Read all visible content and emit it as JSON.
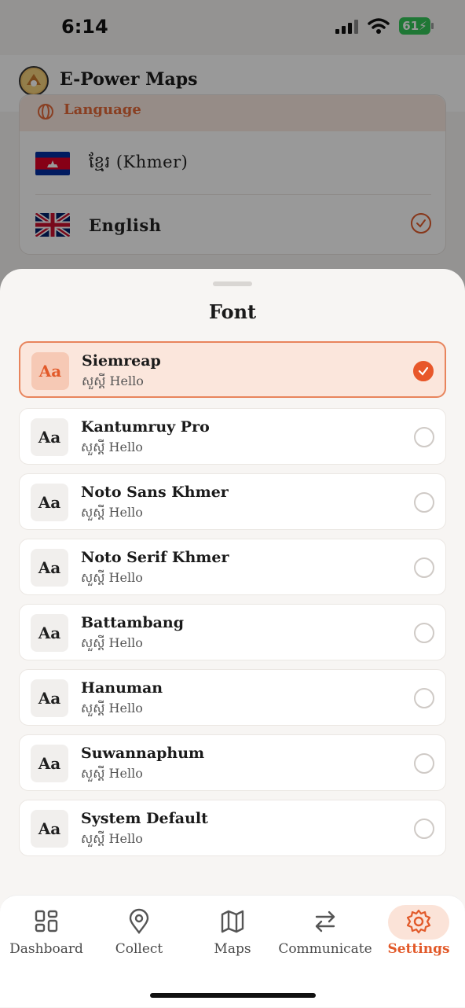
{
  "status_bar": {
    "time": "6:14",
    "battery": "61"
  },
  "app_bar": {
    "title": "E-Power Maps"
  },
  "language_card": {
    "header": "Language",
    "options": [
      {
        "label": "ខ្មែរ (Khmer)",
        "flag": "cambodia-flag-icon",
        "selected": false
      },
      {
        "label": "English",
        "flag": "uk-flag-icon",
        "selected": true
      }
    ]
  },
  "font_sheet": {
    "title": "Font",
    "items": [
      {
        "name": "Siemreap",
        "sample": "សួស្តី Hello",
        "badge": "Aa",
        "selected": true
      },
      {
        "name": "Kantumruy Pro",
        "sample": "សួស្តី Hello",
        "badge": "Aa",
        "selected": false
      },
      {
        "name": "Noto Sans Khmer",
        "sample": "សួស្តី Hello",
        "badge": "Aa",
        "selected": false
      },
      {
        "name": "Noto Serif Khmer",
        "sample": "សួស្តី Hello",
        "badge": "Aa",
        "selected": false
      },
      {
        "name": "Battambang",
        "sample": "សួស្តី Hello",
        "badge": "Aa",
        "selected": false
      },
      {
        "name": "Hanuman",
        "sample": "សួស្តី Hello",
        "badge": "Aa",
        "selected": false
      },
      {
        "name": "Suwannaphum",
        "sample": "សួស្តី Hello",
        "badge": "Aa",
        "selected": false
      },
      {
        "name": "System Default",
        "sample": "សួស្តី Hello",
        "badge": "Aa",
        "selected": false
      }
    ]
  },
  "bottom_nav": {
    "items": [
      {
        "label": "Dashboard",
        "icon": "grid-icon"
      },
      {
        "label": "Collect",
        "icon": "location-pin-icon"
      },
      {
        "label": "Maps",
        "icon": "map-icon"
      },
      {
        "label": "Communicate",
        "icon": "swap-arrows-icon"
      },
      {
        "label": "Settings",
        "icon": "gear-icon",
        "active": true
      }
    ]
  },
  "colors": {
    "accent": "#e8572a",
    "selected_bg": "#fbe6dc",
    "sheet_bg": "#f7f5f3"
  }
}
